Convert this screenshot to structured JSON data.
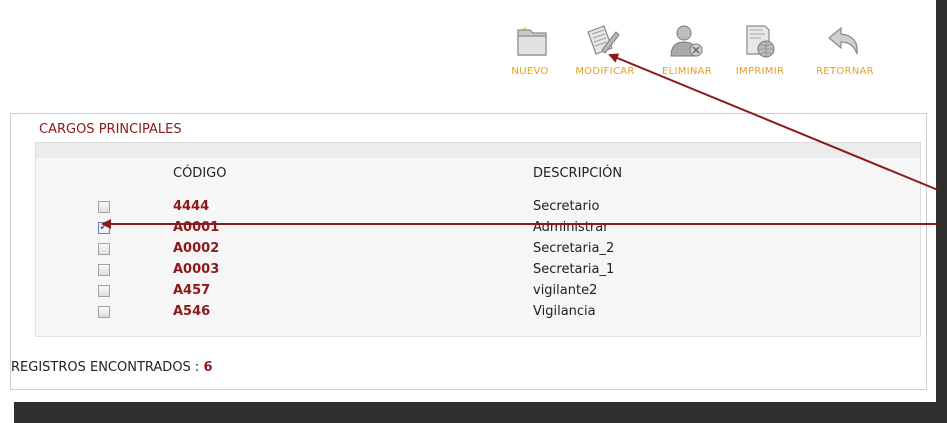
{
  "toolbar": {
    "items": [
      {
        "label": "NUEVO",
        "icon": "folder-icon"
      },
      {
        "label": "MODIFICAR",
        "icon": "edit-document-icon"
      },
      {
        "label": "ELIMINAR",
        "icon": "delete-user-icon"
      },
      {
        "label": "IMPRIMIR",
        "icon": "print-globe-icon"
      },
      {
        "label": "RETORNAR",
        "icon": "return-arrow-icon"
      }
    ]
  },
  "panel": {
    "title": "CARGOS PRINCIPALES",
    "columns": {
      "code": "CÓDIGO",
      "description": "DESCRIPCIÓN"
    },
    "rows": [
      {
        "code": "4444",
        "description": "Secretario",
        "checked": false
      },
      {
        "code": "A0001",
        "description": "Administrar",
        "checked": true
      },
      {
        "code": "A0002",
        "description": "Secretaria_2",
        "checked": false
      },
      {
        "code": "A0003",
        "description": "Secretaria_1",
        "checked": false
      },
      {
        "code": "A457",
        "description": "vigilante2",
        "checked": false
      },
      {
        "code": "A546",
        "description": "Vigilancia",
        "checked": false
      }
    ],
    "footer": {
      "label": "REGISTROS ENCONTRADOS : ",
      "count": "6"
    }
  },
  "colors": {
    "accent_red": "#8b1a1a",
    "toolbar_label": "#e8a020",
    "arrow": "#8b1a1a",
    "frame": "#2f2f2f"
  }
}
